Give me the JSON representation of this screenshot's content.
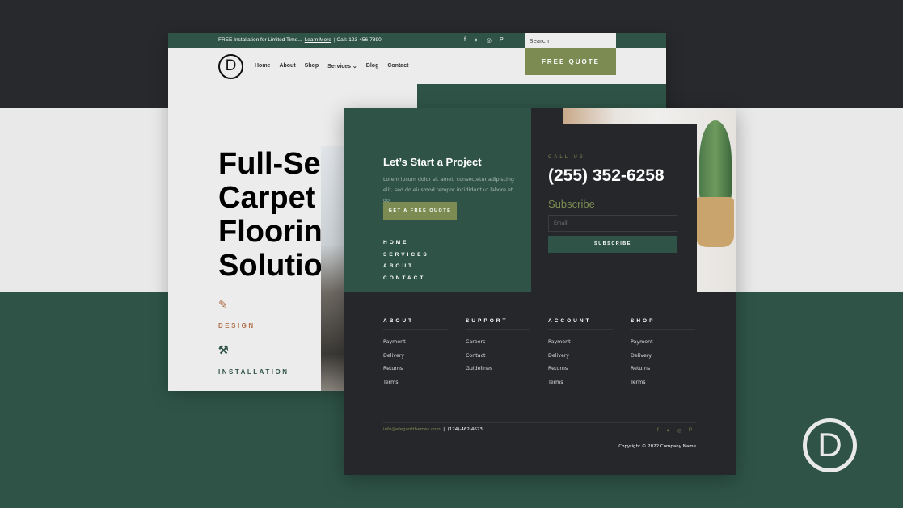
{
  "colors": {
    "green": "#2f5447",
    "olive": "#7c8b52",
    "dark": "#26272b",
    "light": "#ececec",
    "design_accent": "#b0704a"
  },
  "back": {
    "topbar": {
      "promo": "FREE Installation for Limited Time...",
      "learn_more": "Learn More",
      "separator": "|",
      "call": "Call: 123-456-7890",
      "social": [
        "f",
        "t",
        "◎",
        "P"
      ]
    },
    "search_placeholder": "Search",
    "free_quote": "FREE QUOTE",
    "logo": "D",
    "nav": [
      "Home",
      "About",
      "Shop",
      "Services ⌄",
      "Blog",
      "Contact"
    ],
    "hero": [
      "Full-Serv",
      "Carpet &",
      "Flooring",
      "Solution"
    ],
    "services": [
      {
        "icon": "pencil-icon",
        "label": "DESIGN"
      },
      {
        "icon": "hammer-icon",
        "label": "INSTALLATION"
      }
    ]
  },
  "front": {
    "project_title": "Let’s Start a Project",
    "lorem": "Lorem ipsum dolor sit amet, consectetur adipiscing elit, sed do eiusmod tempor incididunt ut labore et dol",
    "cta": "GET A FREE QUOTE",
    "nav": [
      "HOME",
      "SERVICES",
      "ABOUT",
      "CONTACT"
    ],
    "call_us": "CALL US",
    "phone": "(255) 352-6258",
    "subscribe_title": "Subscribe",
    "email_placeholder": "Email",
    "subscribe_button": "SUBSCRIBE",
    "columns": [
      {
        "title": "ABOUT",
        "links": [
          "Payment",
          "Delivery",
          "Returns",
          "Terms"
        ]
      },
      {
        "title": "SUPPORT",
        "links": [
          "Careers",
          "Contact",
          "Guidelines"
        ]
      },
      {
        "title": "ACCOUNT",
        "links": [
          "Payment",
          "Delivery",
          "Returns",
          "Terms"
        ]
      },
      {
        "title": "SHOP",
        "links": [
          "Payment",
          "Delivery",
          "Returns",
          "Terms"
        ]
      }
    ],
    "email": "info@elegantthemes.com",
    "sep": "|",
    "contact_phone": "(124)-462-4623",
    "social": [
      "f",
      "t",
      "◎",
      "P"
    ],
    "copyright": "Copyright © 2022 Company Name"
  },
  "brand_logo": "D"
}
